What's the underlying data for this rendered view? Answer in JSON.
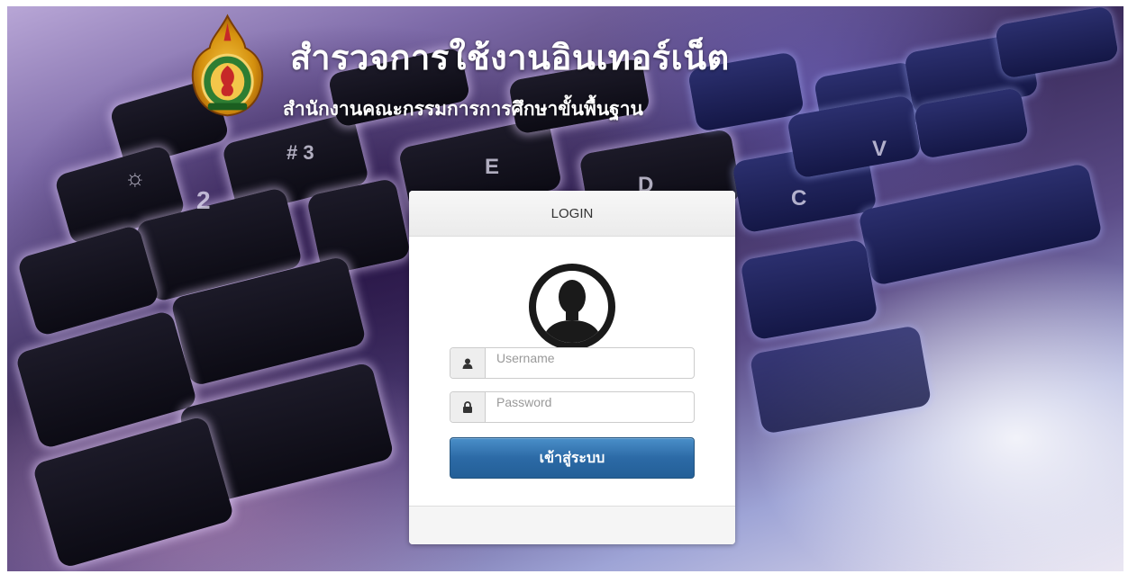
{
  "header": {
    "title": "สำรวจการใช้งานอินเทอร์เน็ต",
    "subtitle": "สำนักงานคณะกรรมการการศึกษาขั้นพื้นฐาน",
    "logo_icon": "government-seal-icon"
  },
  "login": {
    "heading": "LOGIN",
    "avatar_icon": "user-avatar-icon",
    "username_placeholder": "Username",
    "username_value": "",
    "username_icon": "user-icon",
    "password_placeholder": "Password",
    "password_value": "",
    "password_icon": "lock-icon",
    "submit_label": "เข้าสู่ระบบ"
  },
  "colors": {
    "button": "#2c6aa6",
    "panel_header": "#f0f0f0",
    "title_text": "#ffffff"
  }
}
